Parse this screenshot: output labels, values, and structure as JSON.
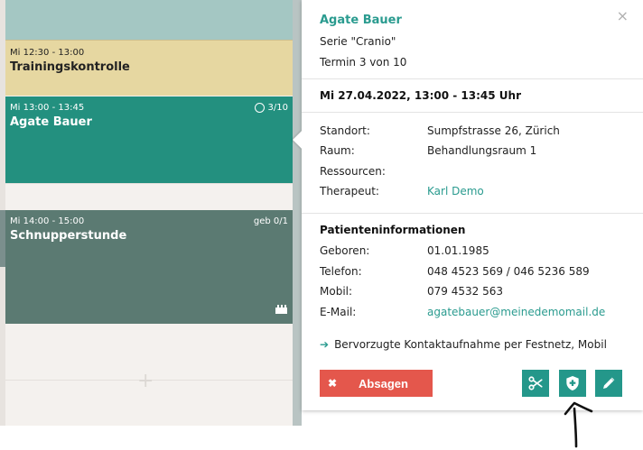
{
  "calendar": {
    "events": [
      {
        "time": "Mi 12:30 - 13:00",
        "title": "Trainingskontrolle"
      },
      {
        "time": "Mi 13:00 - 13:45",
        "title": "Agate Bauer",
        "badge": "3/10"
      },
      {
        "time": "Mi 14:00 - 15:00",
        "title": "Schnupperstunde",
        "badge": "geb 0/1"
      }
    ],
    "add_symbol": "+"
  },
  "popover": {
    "patient_name": "Agate Bauer",
    "series": "Serie \"Cranio\"",
    "appointment_count": "Termin 3 von 10",
    "datetime": "Mi 27.04.2022, 13:00 - 13:45 Uhr",
    "details": [
      {
        "label": "Standort:",
        "value": "Sumpfstrasse 26, Zürich"
      },
      {
        "label": "Raum:",
        "value": "Behandlungsraum 1"
      },
      {
        "label": "Ressourcen:",
        "value": ""
      },
      {
        "label": "Therapeut:",
        "value": "Karl Demo"
      }
    ],
    "patient_section_title": "Patienteninformationen",
    "patient_info": [
      {
        "label": "Geboren:",
        "value": "01.01.1985"
      },
      {
        "label": "Telefon:",
        "value": "048 4523 569 / 046 5236 589"
      },
      {
        "label": "Mobil:",
        "value": "079 4532 563"
      },
      {
        "label": "E-Mail:",
        "value": "agatebauer@meinedemomail.de"
      }
    ],
    "contact_preference": "Bervorzugte Kontaktaufnahme per Festnetz, Mobil",
    "cancel_button": "Absagen",
    "close_symbol": "×"
  },
  "icons": {
    "close": "close-icon",
    "cancel": "x-icon",
    "cut": "scissors-icon",
    "shield": "shield-plus-icon",
    "edit": "pencil-icon",
    "preference": "arrow-right-icon"
  },
  "colors": {
    "accent": "#2a9b8f",
    "button_teal": "#24978a",
    "cancel_red": "#e4574c",
    "event_teal": "#23907f",
    "event_slate": "#5b7a72",
    "event_sand": "#e6d7a1"
  }
}
